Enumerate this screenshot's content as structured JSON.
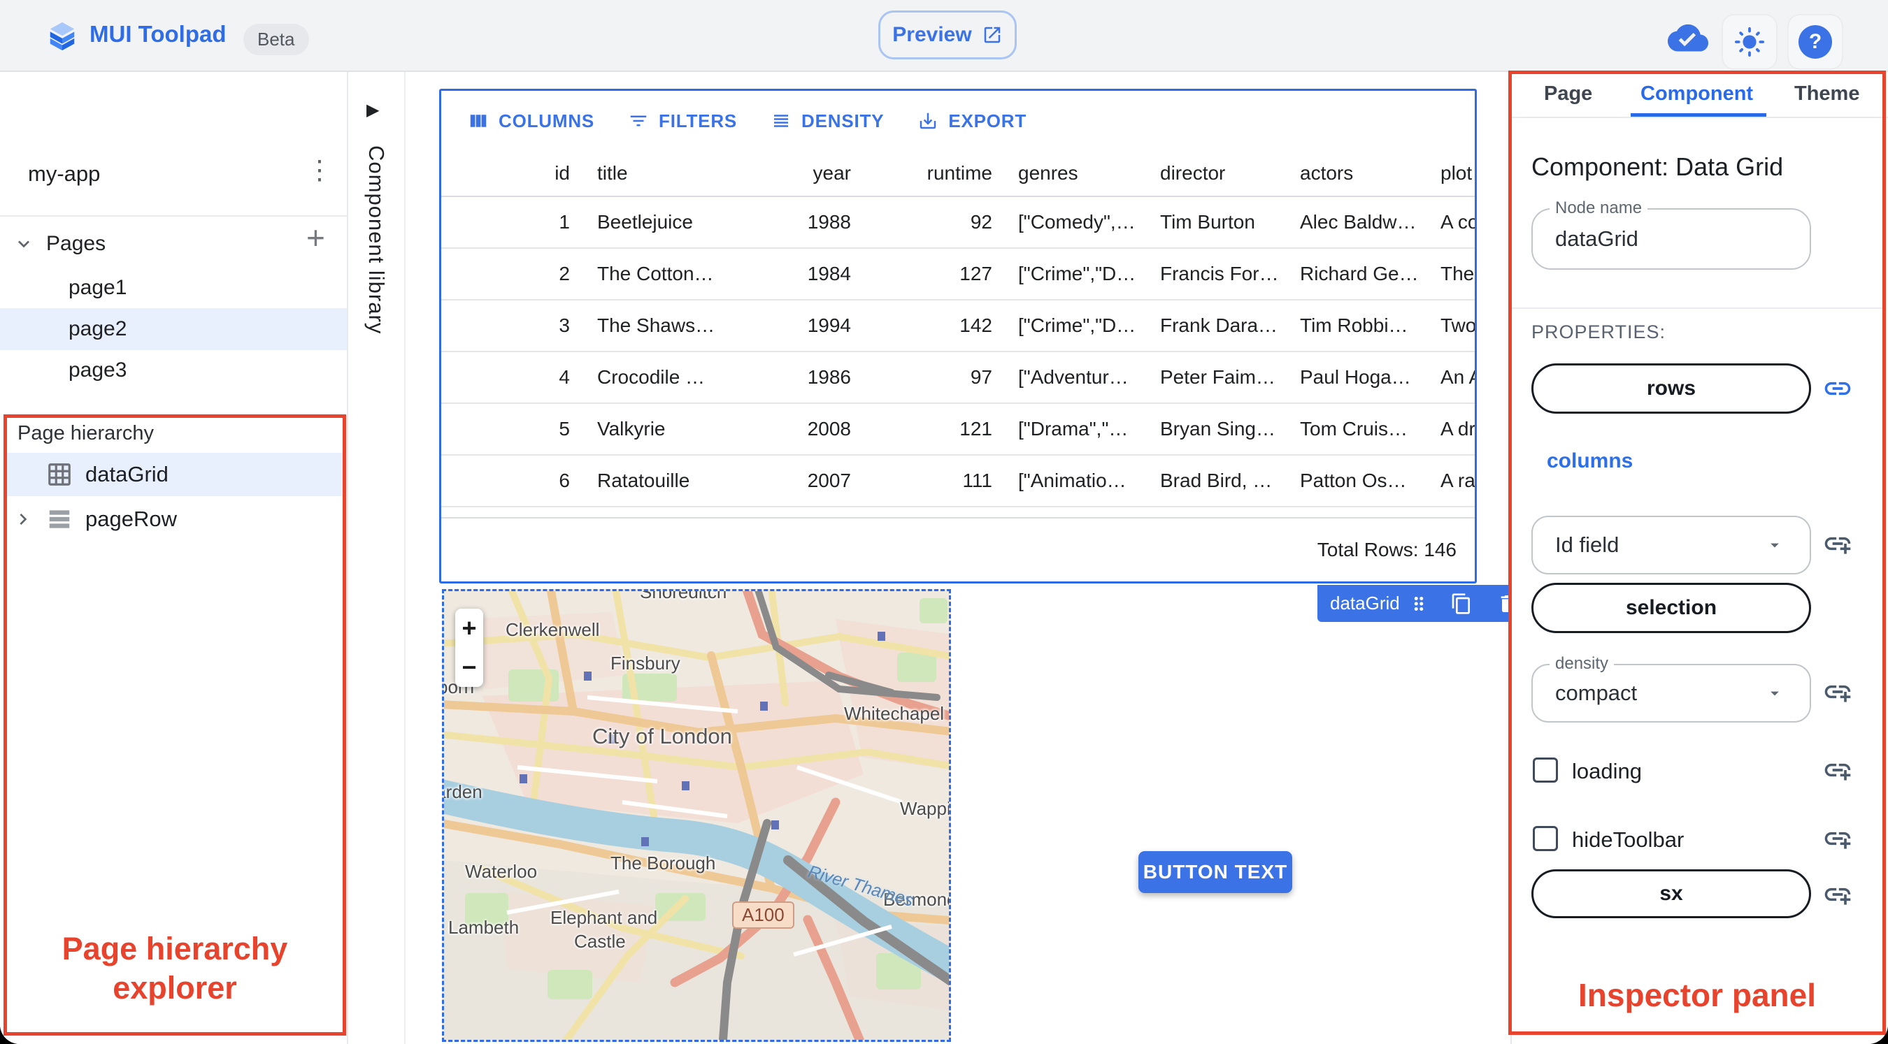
{
  "topbar": {
    "app_name": "MUI Toolpad",
    "beta_label": "Beta",
    "preview_label": "Preview"
  },
  "sidebar": {
    "project_name": "my-app",
    "pages_label": "Pages",
    "pages": [
      {
        "label": "page1"
      },
      {
        "label": "page2"
      },
      {
        "label": "page3"
      }
    ]
  },
  "component_library": {
    "label": "Component library"
  },
  "hierarchy": {
    "title": "Page hierarchy",
    "items": [
      {
        "label": "dataGrid"
      },
      {
        "label": "pageRow"
      }
    ],
    "annotation_line1": "Page hierarchy",
    "annotation_line2": "explorer"
  },
  "grid": {
    "toolbar": [
      {
        "label": "COLUMNS"
      },
      {
        "label": "FILTERS"
      },
      {
        "label": "DENSITY"
      },
      {
        "label": "EXPORT"
      }
    ],
    "columns": [
      "id",
      "title",
      "year",
      "runtime",
      "genres",
      "director",
      "actors",
      "plot"
    ],
    "rows": [
      [
        "1",
        "Beetlejuice",
        "1988",
        "92",
        "[\"Comedy\",…",
        "Tim Burton",
        "Alec Baldw…",
        "A co"
      ],
      [
        "2",
        "The Cotton…",
        "1984",
        "127",
        "[\"Crime\",\"D…",
        "Francis For…",
        "Richard Ge…",
        "The"
      ],
      [
        "3",
        "The Shaws…",
        "1994",
        "142",
        "[\"Crime\",\"D…",
        "Frank Dara…",
        "Tim Robbi…",
        "Two"
      ],
      [
        "4",
        "Crocodile …",
        "1986",
        "97",
        "[\"Adventur…",
        "Peter Faim…",
        "Paul Hoga…",
        "An A"
      ],
      [
        "5",
        "Valkyrie",
        "2008",
        "121",
        "[\"Drama\",\"…",
        "Bryan Sing…",
        "Tom Cruis…",
        "A dr"
      ],
      [
        "6",
        "Ratatouille",
        "2007",
        "111",
        "[\"Animatio…",
        "Brad Bird, …",
        "Patton Os…",
        "A ra"
      ]
    ],
    "footer_label": "Total Rows: 146",
    "selection_chip": "dataGrid"
  },
  "map": {
    "zoom_in": "+",
    "zoom_out": "−",
    "labels": [
      {
        "text": "Shoreditch"
      },
      {
        "text": "Clerkenwell"
      },
      {
        "text": "Finsbury"
      },
      {
        "text": "Whitechapel"
      },
      {
        "text": "Holborn"
      },
      {
        "text": "City of London"
      },
      {
        "text": "Garden"
      },
      {
        "text": "Wapping"
      },
      {
        "text": "Waterloo"
      },
      {
        "text": "The Borough"
      },
      {
        "text": "Lambeth"
      },
      {
        "text": "Elephant and"
      },
      {
        "text": "Castle"
      },
      {
        "text": "Bermondsey"
      }
    ],
    "route_badge": "A100",
    "river_label": "River Thames"
  },
  "button": {
    "label": "BUTTON TEXT"
  },
  "inspector": {
    "tabs": [
      {
        "label": "Page"
      },
      {
        "label": "Component"
      },
      {
        "label": "Theme"
      }
    ],
    "heading": "Component: Data Grid",
    "node_name_label": "Node name",
    "node_name_value": "dataGrid",
    "properties_label": "PROPERTIES:",
    "rows_button": "rows",
    "columns_link": "columns",
    "id_field_label": "Id field",
    "selection_button": "selection",
    "density_label": "density",
    "density_value": "compact",
    "loading_label": "loading",
    "hide_toolbar_label": "hideToolbar",
    "sx_button": "sx",
    "annotation": "Inspector panel"
  },
  "colors": {
    "accent": "#3b73e6",
    "selection_outline": "#2f6be4",
    "annotation_red": "#e8432d",
    "selected_row_bg": "#e9f0fd"
  }
}
